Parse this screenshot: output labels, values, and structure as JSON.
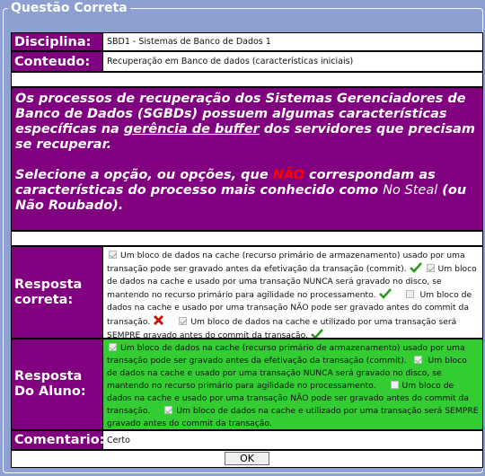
{
  "legend": "Questão Correta",
  "disciplina": {
    "label": "Disciplina:",
    "value": "SBD1 - Sistemas de Banco de Dados 1"
  },
  "conteudo": {
    "label": "Conteudo:",
    "value": "Recuperação em Banco de dados (características iniciais)"
  },
  "question": {
    "p1_a": "Os processos de recuperação dos Sistemas Gerenciadores de Banco de Dados (SGBDs) possuem algumas características específicas na ",
    "p1_u": "gerência de buffer",
    "p1_b": " dos servidores que precisam se recuperar.",
    "p2_a": "Selecione a opção, ou opções, que ",
    "p2_red": "NÃO",
    "p2_b": " correspondam as características do processo mais conhecido como ",
    "p2_c": "No Steal",
    "p2_d": " (ou Não Roubado)."
  },
  "resposta_correta": {
    "label": "Resposta correta:",
    "options": [
      "Um bloco de dados na cache (recurso primário de armazenamento) usado por uma transação pode ser gravado antes da efetivação da transação (commit).",
      "Um bloco de dados na cache e usado por uma transação NUNCA será gravado no disco, se mantendo no recurso primário para agilidade no processamento.",
      "Um bloco de dados na cache e usado por uma transação NÃO pode ser gravado antes do commit da transação.",
      "Um bloco de dados na cache e utilizado por uma transação será SEMPRE gravado antes do commit da transação."
    ]
  },
  "resposta_aluno": {
    "label": "Resposta Do Aluno:",
    "options": [
      "Um bloco de dados na cache (recurso primário de armazenamento) usado por uma transação pode ser gravado antes da efetivação da transação (commit).",
      "Um bloco de dados na cache e usado por uma transação NUNCA será gravado no disco, se mantendo no recurso primário para agilidade no processamento.",
      "Um bloco de dados na cache e usado por uma transação NÃO pode ser gravado antes do commit da transação.",
      "Um bloco de dados na cache e utilizado por uma transação será SEMPRE gravado antes do commit da transação."
    ]
  },
  "comentario": {
    "label": "Comentario:",
    "value": "Certo"
  },
  "ok_button": "OK",
  "colors": {
    "background": "#8e9fd2",
    "label_bg": "#800080",
    "student_bg": "#33cc33",
    "red": "#ff0000"
  }
}
